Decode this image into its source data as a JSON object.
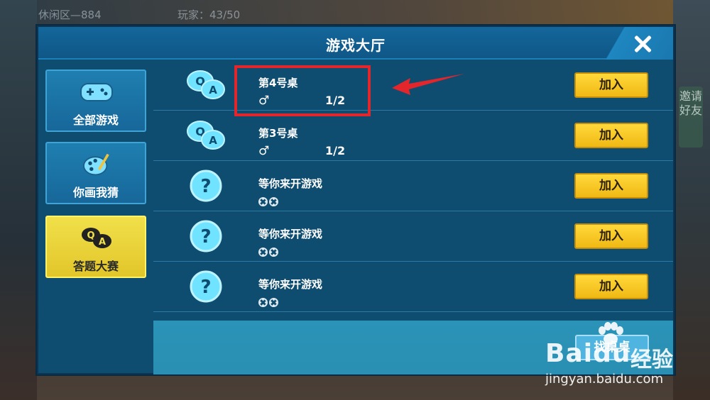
{
  "background": {
    "top_text_left": "休闲区—884",
    "top_text_players": "玩家：43/50",
    "invite_text": "邀请好友"
  },
  "header": {
    "title": "游戏大厅",
    "close_icon": "close-icon"
  },
  "sidebar": {
    "items": [
      {
        "label": "全部游戏",
        "icon": "gamepad-icon",
        "active": false
      },
      {
        "label": "你画我猜",
        "icon": "palette-icon",
        "active": false
      },
      {
        "label": "答题大赛",
        "icon": "qa-bubble-icon",
        "active": true
      }
    ]
  },
  "tables": [
    {
      "name": "第4号桌",
      "icon": "qa-bubble-icon",
      "gender": "♂",
      "players": "1/2",
      "join_label": "加入",
      "highlighted": true
    },
    {
      "name": "第3号桌",
      "icon": "qa-bubble-icon",
      "gender": "♂",
      "players": "1/2",
      "join_label": "加入",
      "highlighted": false
    },
    {
      "name": "等你来开游戏",
      "icon": "question-icon",
      "empty_slots": 2,
      "join_label": "加入"
    },
    {
      "name": "等你来开游戏",
      "icon": "question-icon",
      "empty_slots": 2,
      "join_label": "加入"
    },
    {
      "name": "等你来开游戏",
      "icon": "question-icon",
      "empty_slots": 2,
      "join_label": "加入"
    }
  ],
  "bottom": {
    "find_table_label": "找桌桌"
  },
  "watermark": {
    "logo": "Bai",
    "logo_tail": "du",
    "cn": "经验",
    "url": "jingyan.baidu.com"
  },
  "colors": {
    "panel": "#0f4d70",
    "header": "#14669a",
    "active_tab": "#f1e04a",
    "join_button": "#ffd93a",
    "highlight": "#e2262c"
  }
}
